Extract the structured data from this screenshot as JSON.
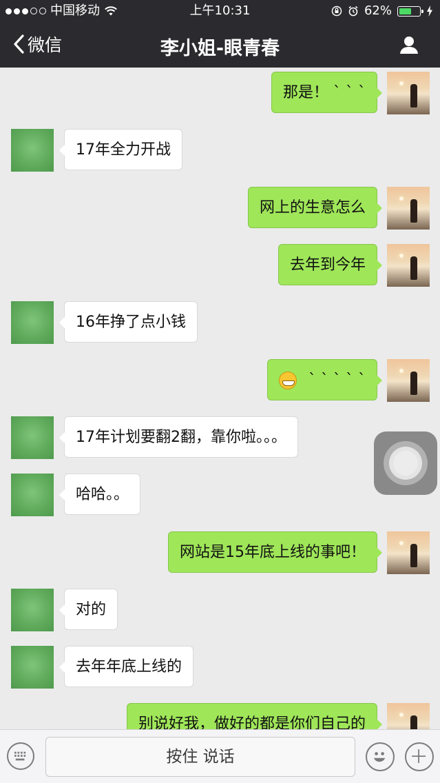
{
  "status": {
    "carrier": "中国移动",
    "time": "上午10:31",
    "battery": "62%",
    "battery_level": 0.62
  },
  "nav": {
    "back_label": "微信",
    "title": "李小姐-眼青春"
  },
  "messages": [
    {
      "side": "right",
      "text": "那是！ ` ` `"
    },
    {
      "side": "left",
      "text": "17年全力开战"
    },
    {
      "side": "right",
      "text": "网上的生意怎么"
    },
    {
      "side": "right",
      "text": "去年到今年"
    },
    {
      "side": "left",
      "text": "16年挣了点小钱"
    },
    {
      "side": "right",
      "text": "` ` ` ` `",
      "emoji": "grinning-face"
    },
    {
      "side": "left",
      "text": "17年计划要翻2翻，靠你啦。。。"
    },
    {
      "side": "left",
      "text": "哈哈。。"
    },
    {
      "side": "right",
      "text": "网站是15年底上线的事吧！"
    },
    {
      "side": "left",
      "text": "对的"
    },
    {
      "side": "left",
      "text": "去年年底上线的"
    },
    {
      "side": "right",
      "text": "别说好我，做好的都是你们自己的"
    }
  ],
  "input": {
    "hold_to_talk": "按住 说话"
  },
  "icons": {
    "back": "chevron-left-icon",
    "profile": "person-icon",
    "keyboard": "keyboard-icon",
    "emoji": "smiley-icon",
    "more": "plus-icon",
    "assistive_touch": "assistive-touch-icon"
  }
}
